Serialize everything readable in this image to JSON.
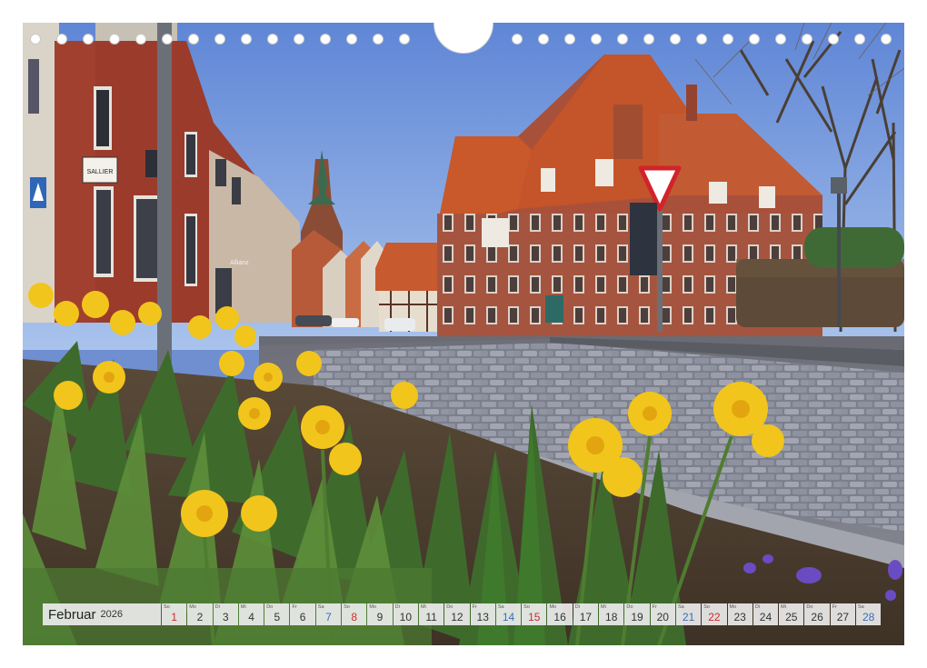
{
  "shop_sign": "SALLIER",
  "building_sign": "Allianz",
  "calendar": {
    "month": "Februar",
    "year": "2026",
    "days": [
      {
        "d": "1",
        "w": "So",
        "t": "sun"
      },
      {
        "d": "2",
        "w": "Mo",
        "t": "wk"
      },
      {
        "d": "3",
        "w": "Di",
        "t": "wk"
      },
      {
        "d": "4",
        "w": "Mi",
        "t": "wk"
      },
      {
        "d": "5",
        "w": "Do",
        "t": "wk"
      },
      {
        "d": "6",
        "w": "Fr",
        "t": "wk"
      },
      {
        "d": "7",
        "w": "Sa",
        "t": "sat"
      },
      {
        "d": "8",
        "w": "So",
        "t": "sun"
      },
      {
        "d": "9",
        "w": "Mo",
        "t": "wk"
      },
      {
        "d": "10",
        "w": "Di",
        "t": "wk"
      },
      {
        "d": "11",
        "w": "Mi",
        "t": "wk"
      },
      {
        "d": "12",
        "w": "Do",
        "t": "wk"
      },
      {
        "d": "13",
        "w": "Fr",
        "t": "wk"
      },
      {
        "d": "14",
        "w": "Sa",
        "t": "sat"
      },
      {
        "d": "15",
        "w": "So",
        "t": "sun"
      },
      {
        "d": "16",
        "w": "Mo",
        "t": "wk"
      },
      {
        "d": "17",
        "w": "Di",
        "t": "wk"
      },
      {
        "d": "18",
        "w": "Mi",
        "t": "wk"
      },
      {
        "d": "19",
        "w": "Do",
        "t": "wk"
      },
      {
        "d": "20",
        "w": "Fr",
        "t": "wk"
      },
      {
        "d": "21",
        "w": "Sa",
        "t": "sat"
      },
      {
        "d": "22",
        "w": "So",
        "t": "sun"
      },
      {
        "d": "23",
        "w": "Mo",
        "t": "wk"
      },
      {
        "d": "24",
        "w": "Di",
        "t": "wk"
      },
      {
        "d": "25",
        "w": "Mi",
        "t": "wk"
      },
      {
        "d": "26",
        "w": "Do",
        "t": "wk"
      },
      {
        "d": "27",
        "w": "Fr",
        "t": "wk"
      },
      {
        "d": "28",
        "w": "Sa",
        "t": "sat"
      }
    ]
  }
}
